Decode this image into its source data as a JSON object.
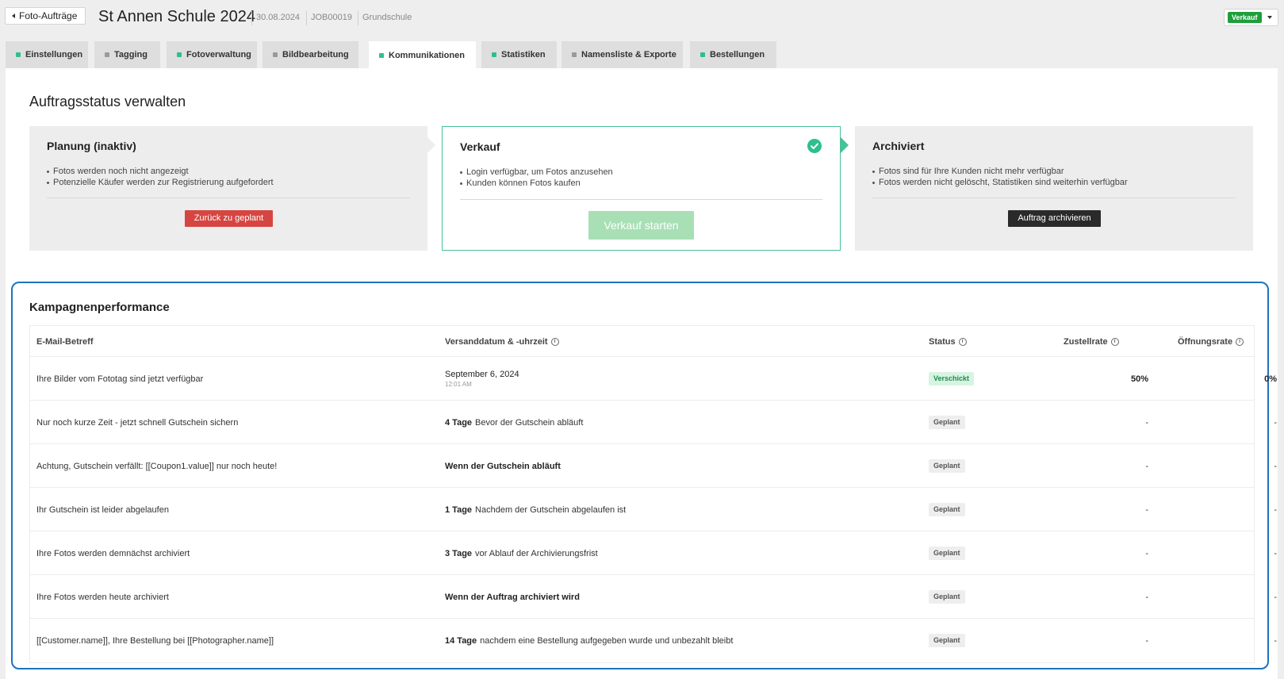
{
  "header": {
    "back_label": "Foto-Aufträge",
    "title": "St Annen Schule 2024",
    "date": "30.08.2024",
    "job_id": "JOB00019",
    "school_type": "Grundschule",
    "status_value": "Verkauf"
  },
  "tabs": [
    {
      "label": "Einstellungen",
      "dot_color": "#2fbf8c"
    },
    {
      "label": "Tagging",
      "dot_color": "#9a9a9a"
    },
    {
      "label": "Fotoverwaltung",
      "dot_color": "#2fbf8c"
    },
    {
      "label": "Bildbearbeitung",
      "dot_color": "#9a9a9a"
    },
    {
      "label": "Kommunikationen",
      "dot_color": "#2fbf8c"
    },
    {
      "label": "Statistiken",
      "dot_color": "#2fbf8c"
    },
    {
      "label": "Namensliste & Exporte",
      "dot_color": "#9a9a9a"
    },
    {
      "label": "Bestellungen",
      "dot_color": "#2fbf8c"
    }
  ],
  "active_tab": "Kommunikationen",
  "status_section": {
    "title": "Auftragsstatus verwalten",
    "stages": [
      {
        "title": "Planung (inaktiv)",
        "bullets": [
          "Fotos werden noch nicht angezeigt",
          "Potenzielle Käufer werden zur Registrierung aufgefordert"
        ],
        "button_label": "Zurück zu geplant"
      },
      {
        "title": "Verkauf",
        "bullets": [
          "Login verfügbar, um Fotos anzusehen",
          "Kunden können Fotos kaufen"
        ],
        "button_label": "Verkauf starten"
      },
      {
        "title": "Archiviert",
        "bullets": [
          "Fotos sind für Ihre Kunden nicht mehr verfügbar",
          "Fotos werden nicht gelöscht, Statistiken sind weiterhin verfügbar"
        ],
        "button_label": "Auftrag archivieren"
      }
    ]
  },
  "campaign": {
    "title": "Kampagnenperformance",
    "columns": {
      "subject": "E-Mail-Betreff",
      "date": "Versanddatum & -uhrzeit",
      "status": "Status",
      "delivery": "Zustellrate",
      "open": "Öffnungsrate"
    },
    "rows": [
      {
        "subject": "Ihre Bilder vom Fototag sind jetzt verfügbar",
        "date_main": "September 6, 2024",
        "date_sub": "12:01 AM",
        "status": "Verschickt",
        "delivery": "50%",
        "open": "0%"
      },
      {
        "subject": "Nur noch kurze Zeit - jetzt schnell Gutschein sichern",
        "date_bold": "4 Tage",
        "date_rest": "Bevor der Gutschein abläuft",
        "status": "Geplant",
        "delivery": "-",
        "open": "-"
      },
      {
        "subject": "Achtung, Gutschein verfällt: [[Coupon1.value]] nur noch heute!",
        "date_bold": "Wenn der Gutschein abläuft",
        "date_rest": "",
        "status": "Geplant",
        "delivery": "-",
        "open": "-"
      },
      {
        "subject": "Ihr Gutschein ist leider abgelaufen",
        "date_bold": "1 Tage",
        "date_rest": "Nachdem der Gutschein abgelaufen ist",
        "status": "Geplant",
        "delivery": "-",
        "open": "-"
      },
      {
        "subject": "Ihre Fotos werden demnächst archiviert",
        "date_bold": "3 Tage",
        "date_rest": "vor Ablauf der Archivierungsfrist",
        "status": "Geplant",
        "delivery": "-",
        "open": "-"
      },
      {
        "subject": "Ihre Fotos werden heute archiviert",
        "date_bold": "Wenn der Auftrag archiviert wird",
        "date_rest": "",
        "status": "Geplant",
        "delivery": "-",
        "open": "-"
      },
      {
        "subject": "[[Customer.name]], Ihre Bestellung bei [[Photographer.name]]",
        "date_bold": "14 Tage",
        "date_rest": "nachdem eine Bestellung aufgegeben wurde und unbezahlt bleibt",
        "status": "Geplant",
        "delivery": "-",
        "open": "-"
      }
    ]
  },
  "icons": {
    "back": "caret-left-icon",
    "dropdown": "caret-down-icon",
    "check": "check-circle-icon",
    "info": "info-icon"
  },
  "colors": {
    "accent_green": "#2fbf8c",
    "status_green": "#1d9e3a",
    "danger_red": "#d64541",
    "highlight_blue": "#1e73be"
  }
}
